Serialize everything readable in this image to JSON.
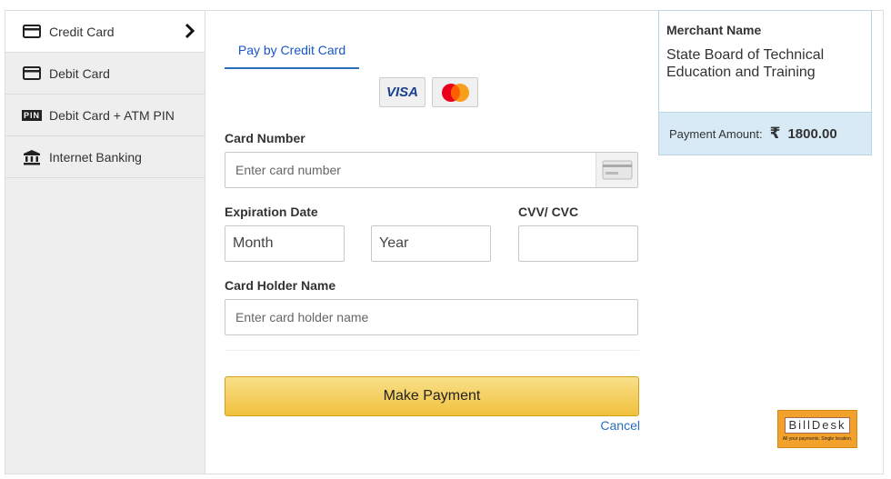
{
  "sidebar": {
    "items": [
      {
        "label": "Credit Card",
        "icon": "credit-card-icon",
        "active": true
      },
      {
        "label": "Debit Card",
        "icon": "debit-card-icon"
      },
      {
        "label": "Debit Card + ATM PIN",
        "icon": "pin-icon",
        "icon_text": "PIN"
      },
      {
        "label": "Internet Banking",
        "icon": "bank-icon"
      }
    ]
  },
  "main": {
    "tab_label": "Pay by Credit Card",
    "card_logos": [
      "VISA",
      "mastercard-icon"
    ],
    "card_number": {
      "label": "Card Number",
      "placeholder": "Enter card number"
    },
    "expiration": {
      "label": "Expiration Date",
      "month": "Month",
      "year": "Year"
    },
    "cvv": {
      "label": "CVV/ CVC"
    },
    "holder": {
      "label": "Card Holder Name",
      "placeholder": "Enter card holder name"
    },
    "pay_button": "Make Payment",
    "cancel": "Cancel"
  },
  "merchant": {
    "title": "Merchant Name",
    "name": "State Board of Technical Education and Training",
    "amount_label": "Payment Amount:",
    "currency": "₹",
    "amount": "1800.00"
  },
  "billdesk": {
    "logo": "BillDesk",
    "tagline": "All your payments. Single location."
  },
  "colors": {
    "accent": "#2a6ebb",
    "button": "#f1c13d",
    "merchant_bg": "#d7eaf5",
    "brand": "#f2a12b"
  }
}
